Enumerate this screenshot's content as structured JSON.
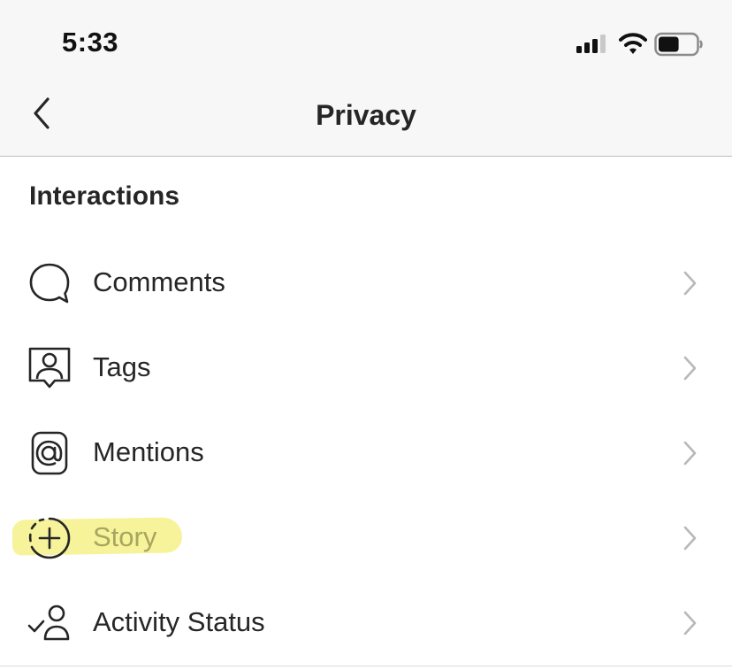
{
  "status_bar": {
    "time": "5:33",
    "signal_icon": "cellular-signal-icon",
    "wifi_icon": "wifi-icon",
    "battery_icon": "battery-icon",
    "battery_level": 0.55
  },
  "nav": {
    "back_icon": "chevron-left-icon",
    "title": "Privacy"
  },
  "section": {
    "title": "Interactions"
  },
  "items": [
    {
      "label": "Comments",
      "icon": "comment-bubble-icon"
    },
    {
      "label": "Tags",
      "icon": "tag-person-icon"
    },
    {
      "label": "Mentions",
      "icon": "at-sign-icon"
    },
    {
      "label": "Story",
      "icon": "story-add-icon",
      "highlighted": true
    },
    {
      "label": "Activity Status",
      "icon": "activity-status-icon"
    }
  ],
  "colors": {
    "highlight": "#f6f39a",
    "chevron": "#b8b8b8",
    "text": "#262626"
  }
}
